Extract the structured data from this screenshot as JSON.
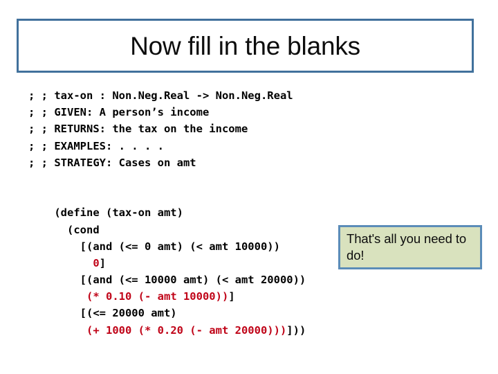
{
  "slide": {
    "title": "Now fill in the blanks",
    "background_color": "#FFFFFF"
  },
  "title_box": {
    "border_color": "#41719C",
    "fill_color": "#FFFFFF"
  },
  "callout": {
    "text": "That's all you need to do!",
    "line1": "That's all you need",
    "line2": "to do!",
    "border_color": "#5B8CB8",
    "fill_color": "#D9E2BE"
  },
  "code": {
    "accent_red": "#C00418",
    "text_color": "#000000",
    "signature_lines": [
      "; ; tax-on : Non.Neg.Real -> Non.Neg.Real",
      "; ; GIVEN: A person’s income",
      "; ; RETURNS: the tax on the income",
      "; ; EXAMPLES: . . . .",
      "; ; STRATEGY: Cases on amt"
    ],
    "body_lines": [
      {
        "segments": [
          {
            "text": "(define (tax-on amt)",
            "color": "black"
          }
        ]
      },
      {
        "segments": [
          {
            "text": "  (cond",
            "color": "black"
          }
        ]
      },
      {
        "segments": [
          {
            "text": "    [(and (<= 0 amt) (< amt 10000))",
            "color": "black"
          }
        ]
      },
      {
        "segments": [
          {
            "text": "      ",
            "color": "black"
          },
          {
            "text": "0",
            "color": "red"
          },
          {
            "text": "]",
            "color": "black"
          }
        ]
      },
      {
        "segments": [
          {
            "text": "    [(and (<= 10000 amt) (< amt 20000))",
            "color": "black"
          }
        ]
      },
      {
        "segments": [
          {
            "text": "     ",
            "color": "black"
          },
          {
            "text": "(* 0.10 (- amt 10000))",
            "color": "red"
          },
          {
            "text": "]",
            "color": "black"
          }
        ]
      },
      {
        "segments": [
          {
            "text": "    [(<= 20000 amt)",
            "color": "black"
          }
        ]
      },
      {
        "segments": [
          {
            "text": "     ",
            "color": "black"
          },
          {
            "text": "(+ 1000 (* 0.20 (- amt 20000)))",
            "color": "red"
          },
          {
            "text": "]))",
            "color": "black"
          }
        ]
      }
    ]
  }
}
